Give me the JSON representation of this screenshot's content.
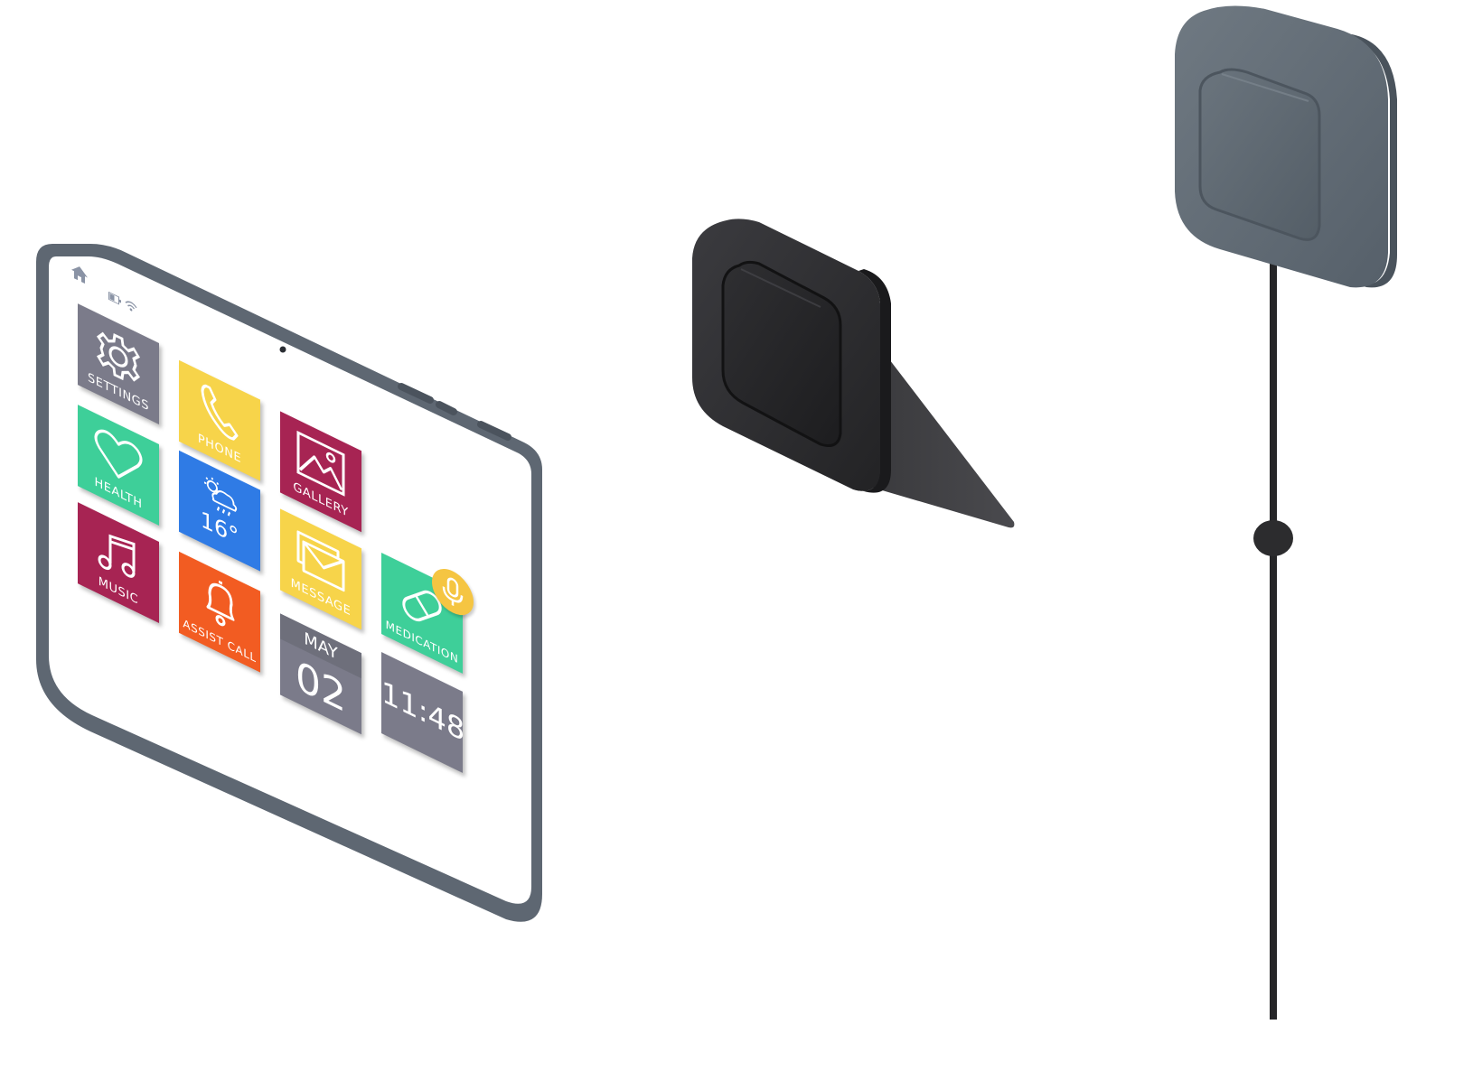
{
  "tablet": {
    "status_icons": [
      "home-icon",
      "battery-icon",
      "wifi-icon"
    ],
    "tiles": [
      {
        "id": "settings",
        "label": "SETTINGS",
        "icon": "gear-icon",
        "color": "#7b7b8a"
      },
      {
        "id": "phone",
        "label": "PHONE",
        "icon": "phone-icon",
        "color": "#f7d44a"
      },
      {
        "id": "gallery",
        "label": "GALLERY",
        "icon": "picture-icon",
        "color": "#a72453"
      },
      {
        "id": "health",
        "label": "HEALTH",
        "icon": "heart-icon",
        "color": "#3ecf99"
      },
      {
        "id": "weather",
        "label": "16°",
        "icon": "weather-icon",
        "color": "#2f7be5"
      },
      {
        "id": "message",
        "label": "MESSAGE",
        "icon": "envelope-icon",
        "color": "#f7d44a"
      },
      {
        "id": "medication",
        "label": "MEDICATION",
        "icon": "pill-icon",
        "color": "#3ecf99"
      },
      {
        "id": "music",
        "label": "MUSIC",
        "icon": "music-note-icon",
        "color": "#a72453"
      },
      {
        "id": "assist",
        "label": "ASSIST CALL",
        "icon": "bell-icon",
        "color": "#f25c22"
      },
      {
        "id": "clock",
        "label": "11:48",
        "icon": "",
        "color": "#7b7b8a"
      },
      {
        "id": "date",
        "month": "MAY",
        "day": "02",
        "icon": "calendar-icon",
        "color": "#7b7b8a"
      }
    ],
    "mic_badge_color": "#f5c542"
  },
  "devices": {
    "button_color": "#333336",
    "pendant_color": "#616b74",
    "cord_color": "#262628"
  }
}
